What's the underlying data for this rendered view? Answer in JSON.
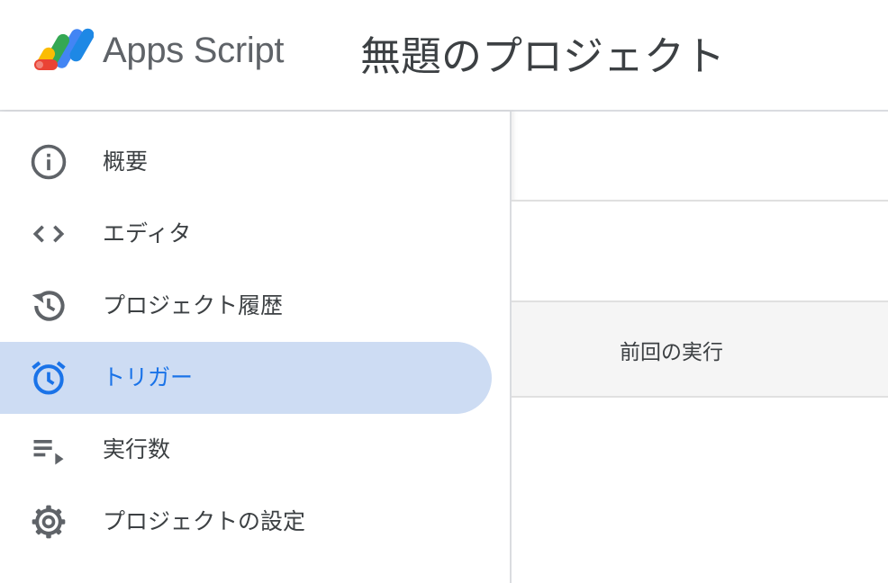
{
  "header": {
    "app_name": "Apps Script",
    "project_title": "無題のプロジェクト",
    "logo_icon": "apps-script-logo-icon"
  },
  "sidebar": {
    "active_color": "#1a73e8",
    "active_background": "#cddcf3",
    "items": [
      {
        "label": "概要",
        "icon": "info-icon",
        "active": false
      },
      {
        "label": "エディタ",
        "icon": "code-icon",
        "active": false
      },
      {
        "label": "プロジェクト履歴",
        "icon": "history-icon",
        "active": false
      },
      {
        "label": "トリガー",
        "icon": "alarm-clock-icon",
        "active": true
      },
      {
        "label": "実行数",
        "icon": "playlist-play-icon",
        "active": false
      },
      {
        "label": "プロジェクトの設定",
        "icon": "gear-icon",
        "active": false
      }
    ]
  },
  "main": {
    "table": {
      "columns": [
        "前回の実行"
      ]
    }
  }
}
